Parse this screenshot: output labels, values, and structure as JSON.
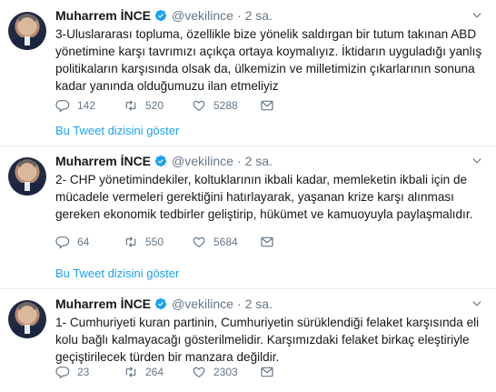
{
  "tweets": [
    {
      "author_name": "Muharrem İNCE",
      "handle": "@vekilince",
      "separator": "·",
      "time": "2 sa.",
      "text": "3-Uluslararası topluma, özellikle bize yönelik saldırgan bir tutum takınan ABD yönetimine karşı tavrımızı açıkça ortaya koymalıyız. İktidarın uyguladığı yanlış politikaların karşısında olsak da, ülkemizin ve milletimizin çıkarlarının sonuna kadar yanında olduğumuzu ilan etmeliyiz",
      "replies": "142",
      "retweets": "520",
      "likes": "5288",
      "show_thread": "Bu Tweet dizisini göster"
    },
    {
      "author_name": "Muharrem İNCE",
      "handle": "@vekilince",
      "separator": "·",
      "time": "2 sa.",
      "text": "2- CHP yönetimindekiler, koltuklarının ikbali kadar, memleketin ikbali için de mücadele vermeleri gerektiğini hatırlayarak, yaşanan krize karşı alınması gereken ekonomik tedbirler geliştirip, hükümet ve kamuoyuyla paylaşmalıdır.",
      "replies": "64",
      "retweets": "550",
      "likes": "5684",
      "show_thread": "Bu Tweet dizisini göster"
    },
    {
      "author_name": "Muharrem İNCE",
      "handle": "@vekilince",
      "separator": "·",
      "time": "2 sa.",
      "text": "1- Cumhuriyeti kuran partinin, Cumhuriyetin sürüklendiği felaket karşısında eli kolu bağlı kalmayacağı gösterilmelidir. Karşımızdaki felaket birkaç eleştiriyle geçiştirilecek türden bir manzara değildir.",
      "replies": "23",
      "retweets": "264",
      "likes": "2303"
    }
  ],
  "colors": {
    "accent": "#1da1f2",
    "secondary_text": "#657786",
    "primary_text": "#14171a",
    "divider": "#e6ecf0"
  },
  "icons": {
    "verified": "verified-badge-icon",
    "caret": "chevron-down-icon",
    "reply": "reply-icon",
    "retweet": "retweet-icon",
    "like": "heart-icon",
    "dm": "envelope-icon"
  }
}
